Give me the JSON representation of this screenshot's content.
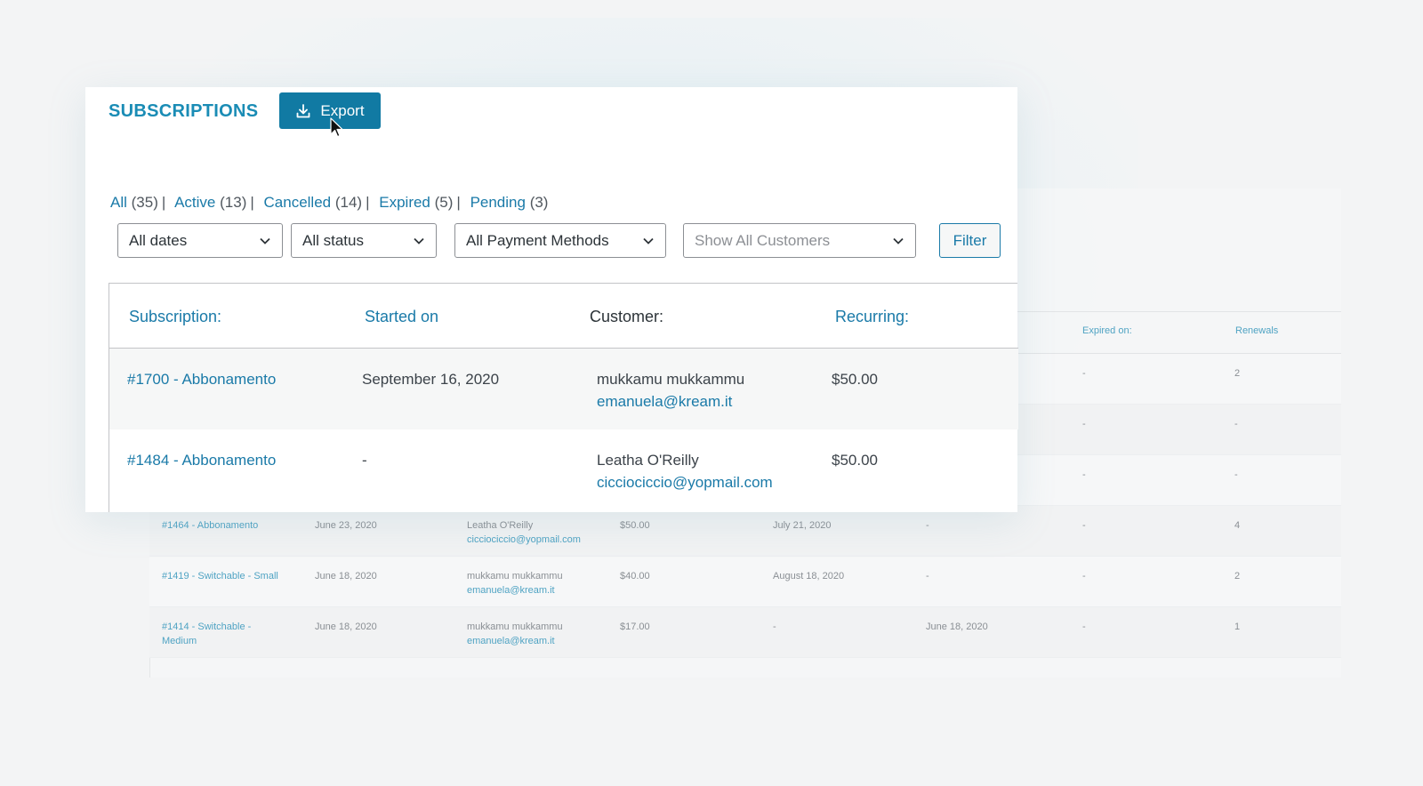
{
  "page": {
    "title": "SUBSCRIPTIONS",
    "export_label": "Export"
  },
  "status_filters": [
    {
      "label": "All",
      "count": "(35)"
    },
    {
      "label": "Active",
      "count": "(13)"
    },
    {
      "label": "Cancelled",
      "count": "(14)"
    },
    {
      "label": "Expired",
      "count": "(5)"
    },
    {
      "label": "Pending",
      "count": "(3)"
    }
  ],
  "filters": {
    "dates": "All dates",
    "status": "All status",
    "payment": "All Payment Methods",
    "customers": "Show All Customers",
    "filter_label": "Filter"
  },
  "table": {
    "headers": {
      "subscription": "Subscription:",
      "started": "Started on",
      "customer": "Customer:",
      "recurring": "Recurring:"
    },
    "rows": [
      {
        "subscription": "#1700 - Abbonamento",
        "started": "September 16, 2020",
        "customer_name": "mukkamu mukkammu",
        "customer_email": "emanuela@kream.it",
        "recurring": "$50.00"
      },
      {
        "subscription": "#1484 - Abbonamento",
        "started": "-",
        "customer_name": "Leatha O'Reilly",
        "customer_email": "cicciociccio@yopmail.com",
        "recurring": "$50.00"
      }
    ]
  },
  "background_table": {
    "headers": {
      "expired_on": "Expired on:",
      "renewals": "Renewals"
    },
    "partial_rows": [
      {
        "c1": "-",
        "c2": "2"
      },
      {
        "c1": "-",
        "c2": "-"
      },
      {
        "c1": "-",
        "c2": "-"
      }
    ],
    "rows": [
      {
        "subscription": "#1464 - Abbonamento",
        "started": "June 23, 2020",
        "customer_name": "Leatha O'Reilly",
        "customer_email": "cicciociccio@yopmail.com",
        "recurring": "$50.00",
        "col5": "July 21, 2020",
        "col6": "-",
        "col7": "-",
        "renewals": "4"
      },
      {
        "subscription": "#1419 - Switchable - Small",
        "started": "June 18, 2020",
        "customer_name": "mukkamu mukkammu",
        "customer_email": "emanuela@kream.it",
        "recurring": "$40.00",
        "col5": "August 18, 2020",
        "col6": "-",
        "col7": "-",
        "renewals": "2"
      },
      {
        "subscription_line1": "#1414 - Switchable -",
        "subscription_line2": "Medium",
        "started": "June 18, 2020",
        "customer_name": "mukkamu mukkammu",
        "customer_email": "emanuela@kream.it",
        "recurring": "$17.00",
        "col5": "-",
        "col6": "June 18, 2020",
        "col7": "-",
        "renewals": "1"
      }
    ]
  },
  "colors": {
    "accent": "#1a7aa8",
    "export_button": "#117aa3",
    "title": "#1a8cb5"
  }
}
